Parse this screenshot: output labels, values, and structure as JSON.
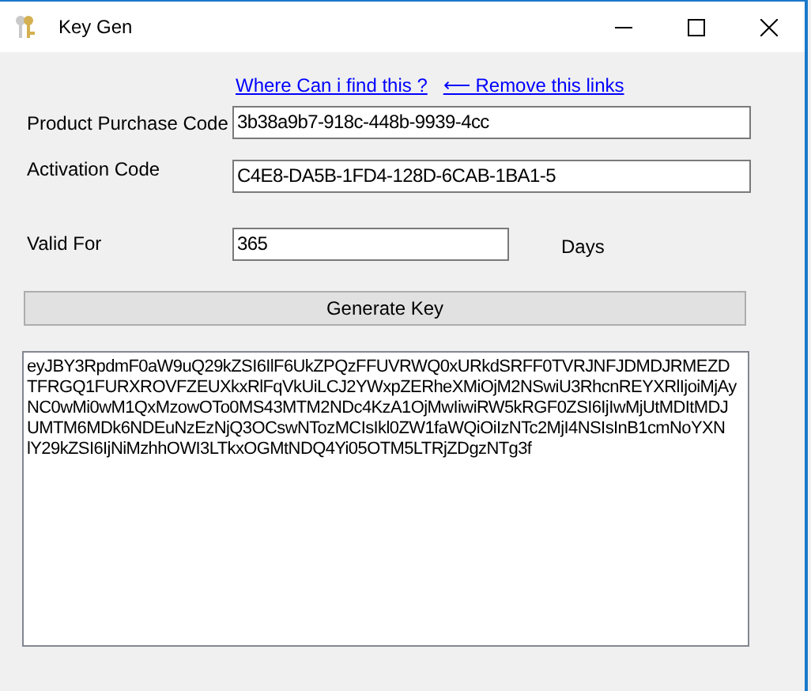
{
  "window": {
    "title": "Key Gen"
  },
  "links": [
    "Where Can i find this ?",
    "⟵ Remove this links"
  ],
  "fields": [
    {
      "label": "Product Purchase Code",
      "value": "3b38a9b7-918c-448b-9939-4cc"
    },
    {
      "label": "Activation Code",
      "value": "C4E8-DA5B-1FD4-128D-6CAB-1BA1-5"
    },
    {
      "label": "Valid For",
      "value": "365",
      "unit": "Days"
    }
  ],
  "generate_button": "Generate Key",
  "output_lines": [
    "eyJBY3RpdmF0aW9uQ29kZSI6IlF6UkZPQzFFUVRWQ0xURkdSRFF0TVRJNFJDMDJRMEZD",
    "TFRGQ1FURXROVFZEUXkxRlFqVkUiLCJ2YWxpZERheXMiOjM2NSwiU3RhcnREYXRlIjoiMjAy",
    "NC0wMi0wM1QxMzowOTo0MS43MTM2NDc4KzA1OjMwIiwiRW5kRGF0ZSI6IjIwMjUtMDItMDJ",
    "UMTM6MDk6NDEuNzEzNjQ3OCswNTozMCIsIkl0ZW1faWQiOiIzNTc2MjI4NSIsInB1cmNoYXN",
    "lY29kZSI6IjNiMzhhOWI3LTkxOGMtNDQ4Yi05OTM5LTRjZDgzNTg3f"
  ]
}
